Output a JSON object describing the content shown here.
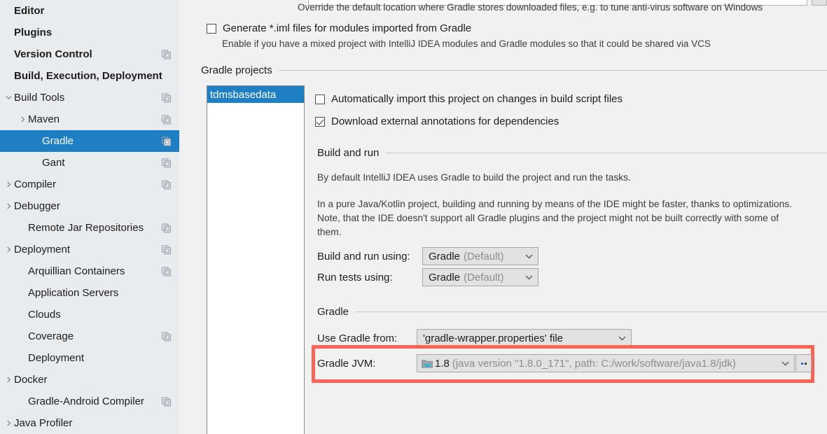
{
  "sidebar": {
    "items": [
      {
        "label": "Editor",
        "bold": true,
        "indent": 0,
        "twisty": "none",
        "copy": false,
        "selected": false
      },
      {
        "label": "Plugins",
        "bold": true,
        "indent": 0,
        "twisty": "none",
        "copy": false,
        "selected": false
      },
      {
        "label": "Version Control",
        "bold": true,
        "indent": 0,
        "twisty": "none",
        "copy": true,
        "selected": false
      },
      {
        "label": "Build, Execution, Deployment",
        "bold": true,
        "indent": 0,
        "twisty": "none",
        "copy": false,
        "selected": false
      },
      {
        "label": "Build Tools",
        "bold": false,
        "indent": 0,
        "twisty": "down",
        "copy": true,
        "selected": false
      },
      {
        "label": "Maven",
        "bold": false,
        "indent": 1,
        "twisty": "right",
        "copy": true,
        "selected": false
      },
      {
        "label": "Gradle",
        "bold": false,
        "indent": 2,
        "twisty": "none",
        "copy": true,
        "selected": true
      },
      {
        "label": "Gant",
        "bold": false,
        "indent": 2,
        "twisty": "none",
        "copy": true,
        "selected": false
      },
      {
        "label": "Compiler",
        "bold": false,
        "indent": 0,
        "twisty": "right",
        "copy": true,
        "selected": false
      },
      {
        "label": "Debugger",
        "bold": false,
        "indent": 0,
        "twisty": "right",
        "copy": false,
        "selected": false
      },
      {
        "label": "Remote Jar Repositories",
        "bold": false,
        "indent": 1,
        "twisty": "none",
        "copy": true,
        "selected": false
      },
      {
        "label": "Deployment",
        "bold": false,
        "indent": 0,
        "twisty": "right",
        "copy": true,
        "selected": false
      },
      {
        "label": "Arquillian Containers",
        "bold": false,
        "indent": 1,
        "twisty": "none",
        "copy": true,
        "selected": false
      },
      {
        "label": "Application Servers",
        "bold": false,
        "indent": 1,
        "twisty": "none",
        "copy": false,
        "selected": false
      },
      {
        "label": "Clouds",
        "bold": false,
        "indent": 1,
        "twisty": "none",
        "copy": false,
        "selected": false
      },
      {
        "label": "Coverage",
        "bold": false,
        "indent": 1,
        "twisty": "none",
        "copy": true,
        "selected": false
      },
      {
        "label": "Deployment",
        "bold": false,
        "indent": 1,
        "twisty": "none",
        "copy": false,
        "selected": false
      },
      {
        "label": "Docker",
        "bold": false,
        "indent": 0,
        "twisty": "right",
        "copy": false,
        "selected": false
      },
      {
        "label": "Gradle-Android Compiler",
        "bold": false,
        "indent": 1,
        "twisty": "none",
        "copy": true,
        "selected": false
      },
      {
        "label": "Java Profiler",
        "bold": false,
        "indent": 0,
        "twisty": "right",
        "copy": false,
        "selected": false
      }
    ]
  },
  "content": {
    "override_hint": "Override the default location where Gradle stores downloaded files, e.g. to tune anti-virus software on Windows",
    "generate_iml_label": "Generate *.iml files for modules imported from Gradle",
    "generate_iml_hint": "Enable if you have a mixed project with IntelliJ IDEA modules and Gradle modules so that it could be shared via VCS",
    "gradle_projects_group": "Gradle projects",
    "project_list": [
      {
        "name": "tdmsbasedata",
        "selected": true
      }
    ],
    "auto_import_label": "Automatically import this project on changes in build script files",
    "download_annotations_label": "Download external annotations for dependencies",
    "build_and_run_group": "Build and run",
    "build_run_para_1": "By default IntelliJ IDEA uses Gradle to build the project and run the tasks.",
    "build_run_para_2": "In a pure Java/Kotlin project, building and running by means of the IDE might be faster, thanks to optimizations. Note, that the IDE doesn't support all Gradle plugins and the project might not be built correctly with some of them.",
    "build_run_using_label": "Build and run using:",
    "build_run_using_value": "Gradle",
    "build_run_using_suffix": "(Default)",
    "run_tests_using_label": "Run tests using:",
    "run_tests_using_value": "Gradle",
    "run_tests_using_suffix": "(Default)",
    "gradle_group": "Gradle",
    "use_gradle_from_label": "Use Gradle from:",
    "use_gradle_from_value": "'gradle-wrapper.properties' file",
    "gradle_jvm_label": "Gradle JVM:",
    "gradle_jvm_version": "1.8",
    "gradle_jvm_details": "(java version \"1.8.0_171\", path: C:/work/software/java1.8/jdk)",
    "jvm_browse_button": "...",
    "highlight_color": "#fb6454",
    "accent_color": "#1e7fc4"
  }
}
